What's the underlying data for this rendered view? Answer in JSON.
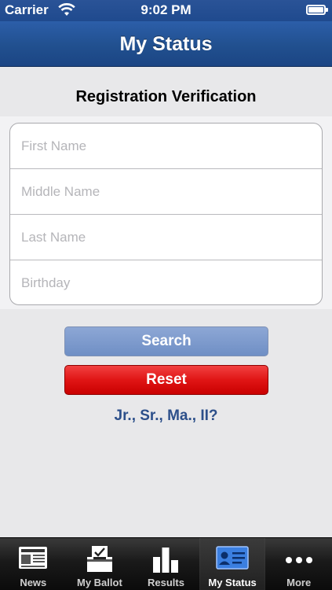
{
  "status_bar": {
    "carrier": "Carrier",
    "time": "9:02 PM"
  },
  "nav": {
    "title": "My Status"
  },
  "form": {
    "section_title": "Registration Verification",
    "fields": [
      {
        "placeholder": "First Name",
        "value": ""
      },
      {
        "placeholder": "Middle Name",
        "value": ""
      },
      {
        "placeholder": "Last Name",
        "value": ""
      },
      {
        "placeholder": "Birthday",
        "value": ""
      }
    ]
  },
  "buttons": {
    "search": "Search",
    "reset": "Reset"
  },
  "suffix_link": "Jr., Sr., Ma., II?",
  "tabs": [
    {
      "label": "News",
      "icon": "newspaper-icon",
      "selected": false
    },
    {
      "label": "My Ballot",
      "icon": "ballot-box-icon",
      "selected": false
    },
    {
      "label": "Results",
      "icon": "bar-chart-icon",
      "selected": false
    },
    {
      "label": "My Status",
      "icon": "id-card-icon",
      "selected": true
    },
    {
      "label": "More",
      "icon": "more-dots-icon",
      "selected": false
    }
  ],
  "colors": {
    "nav_blue": "#21508f",
    "search_button": "#7b9acd",
    "reset_button": "#e01515",
    "link_blue": "#2c4f8a"
  }
}
